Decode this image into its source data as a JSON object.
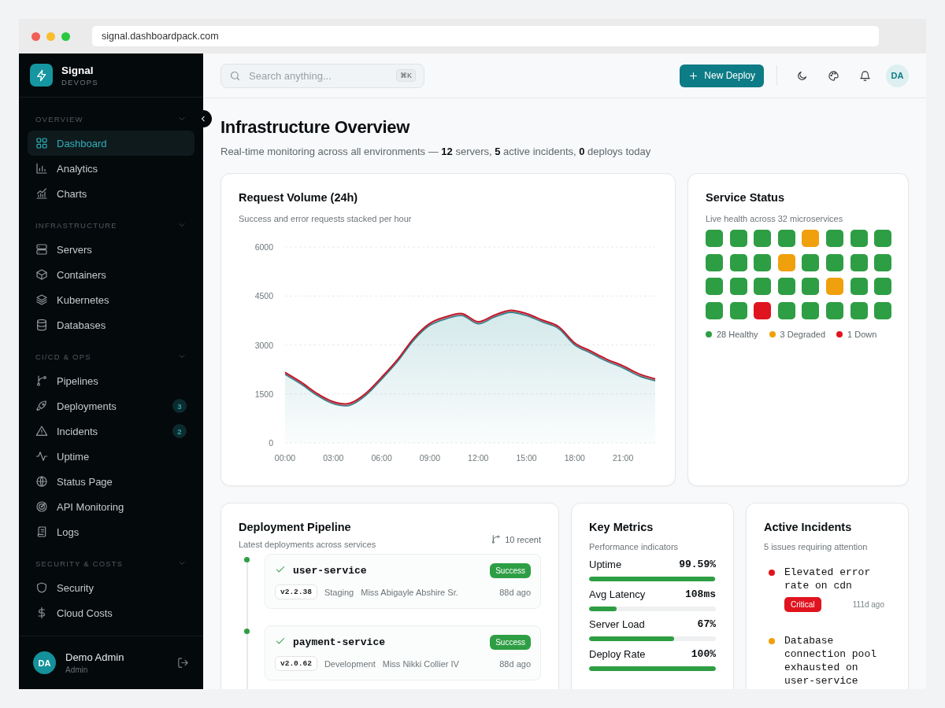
{
  "browser": {
    "url": "signal.dashboardpack.com"
  },
  "sidebar": {
    "brand": {
      "name": "Signal",
      "tagline": "DEVOPS"
    },
    "sections": [
      {
        "title": "OVERVIEW",
        "expanded": true,
        "items": [
          {
            "label": "Dashboard",
            "selected": true
          },
          {
            "label": "Analytics",
            "selected": false
          },
          {
            "label": "Charts",
            "selected": false
          }
        ]
      },
      {
        "title": "INFRASTRUCTURE",
        "expanded": true,
        "items": [
          {
            "label": "Servers",
            "selected": false
          },
          {
            "label": "Containers",
            "selected": false
          },
          {
            "label": "Kubernetes",
            "selected": false
          },
          {
            "label": "Databases",
            "selected": false
          }
        ]
      },
      {
        "title": "CI/CD & OPS",
        "expanded": true,
        "items": [
          {
            "label": "Pipelines",
            "selected": false
          },
          {
            "label": "Deployments",
            "selected": false,
            "badge": "3"
          },
          {
            "label": "Incidents",
            "selected": false,
            "badge": "2"
          },
          {
            "label": "Uptime",
            "selected": false
          },
          {
            "label": "Status Page",
            "selected": false
          },
          {
            "label": "API Monitoring",
            "selected": false
          },
          {
            "label": "Logs",
            "selected": false
          }
        ]
      },
      {
        "title": "SECURITY & COSTS",
        "expanded": true,
        "items": [
          {
            "label": "Security",
            "selected": false
          },
          {
            "label": "Cloud Costs",
            "selected": false
          }
        ]
      }
    ],
    "user": {
      "initials": "DA",
      "name": "Demo Admin",
      "role": "Admin"
    }
  },
  "topbar": {
    "search": {
      "placeholder": "Search anything...",
      "shortcut": "⌘K"
    },
    "new_deploy": "New Deploy",
    "avatar": "DA"
  },
  "page": {
    "title": "Infrastructure Overview",
    "subtitle": "Real-time monitoring across all environments — **12** servers, **5** active incidents, **0** deploys today"
  },
  "request_volume": {
    "title": "Request Volume (24h)",
    "subtitle": "Success and error requests stacked per hour",
    "chart_data": {
      "type": "area",
      "stacked": true,
      "grid": true,
      "x": [
        0,
        1,
        2,
        3,
        4,
        5,
        6,
        7,
        8,
        9,
        10,
        11,
        12,
        13,
        14,
        15,
        16,
        17,
        18,
        19,
        20,
        21,
        22,
        23
      ],
      "series": [
        {
          "color": "#2a8f99",
          "values": [
            2100,
            1800,
            1450,
            1200,
            1150,
            1450,
            1950,
            2500,
            3150,
            3600,
            3800,
            3900,
            3650,
            3850,
            4000,
            3900,
            3700,
            3500,
            3000,
            2750,
            2500,
            2300,
            2050,
            1900
          ]
        },
        {
          "color": "#c0182a",
          "values": [
            60,
            60,
            60,
            60,
            60,
            60,
            60,
            60,
            60,
            60,
            60,
            60,
            60,
            60,
            60,
            60,
            60,
            60,
            60,
            60,
            60,
            60,
            60,
            60
          ]
        }
      ],
      "xlim": [
        0,
        23
      ],
      "ylim": [
        0,
        6000
      ],
      "yticks": [
        0,
        1500,
        3000,
        4500,
        6000
      ],
      "xticks": [
        {
          "value": 0,
          "label": "00:00"
        },
        {
          "value": 3,
          "label": "03:00"
        },
        {
          "value": 6,
          "label": "06:00"
        },
        {
          "value": 9,
          "label": "09:00"
        },
        {
          "value": 12,
          "label": "12:00"
        },
        {
          "value": 15,
          "label": "15:00"
        },
        {
          "value": 18,
          "label": "18:00"
        },
        {
          "value": 21,
          "label": "21:00"
        }
      ]
    }
  },
  "service_status": {
    "title": "Service Status",
    "subtitle": "Live health across 32 microservices",
    "services": [
      {
        "color": "#2e9e44"
      },
      {
        "color": "#2e9e44"
      },
      {
        "color": "#2e9e44"
      },
      {
        "color": "#2e9e44"
      },
      {
        "color": "#f0a00c"
      },
      {
        "color": "#2e9e44"
      },
      {
        "color": "#2e9e44"
      },
      {
        "color": "#2e9e44"
      },
      {
        "color": "#2e9e44"
      },
      {
        "color": "#2e9e44"
      },
      {
        "color": "#2e9e44"
      },
      {
        "color": "#f0a00c"
      },
      {
        "color": "#2e9e44"
      },
      {
        "color": "#2e9e44"
      },
      {
        "color": "#2e9e44"
      },
      {
        "color": "#2e9e44"
      },
      {
        "color": "#2e9e44"
      },
      {
        "color": "#2e9e44"
      },
      {
        "color": "#2e9e44"
      },
      {
        "color": "#2e9e44"
      },
      {
        "color": "#2e9e44"
      },
      {
        "color": "#f0a00c"
      },
      {
        "color": "#2e9e44"
      },
      {
        "color": "#2e9e44"
      },
      {
        "color": "#2e9e44"
      },
      {
        "color": "#2e9e44"
      },
      {
        "color": "#e0141e"
      },
      {
        "color": "#2e9e44"
      },
      {
        "color": "#2e9e44"
      },
      {
        "color": "#2e9e44"
      },
      {
        "color": "#2e9e44"
      },
      {
        "color": "#2e9e44"
      }
    ],
    "legend": [
      {
        "label": "28 Healthy",
        "color": "#2e9e44"
      },
      {
        "label": "3 Degraded",
        "color": "#f0a00c"
      },
      {
        "label": "1 Down",
        "color": "#e0141e"
      }
    ]
  },
  "deployment_pipeline": {
    "title": "Deployment Pipeline",
    "subtitle": "Latest deployments across services",
    "count": "10 recent",
    "deployments": [
      {
        "service": "user-service",
        "status": "Success",
        "version": "v2.2.38",
        "environment": "Staging",
        "author": "Miss Abigayle Abshire Sr.",
        "time": "88d ago"
      },
      {
        "service": "payment-service",
        "status": "Success",
        "version": "v2.0.62",
        "environment": "Development",
        "author": "Miss Nikki Collier IV",
        "time": "88d ago"
      }
    ]
  },
  "key_metrics": {
    "title": "Key Metrics",
    "subtitle": "Performance indicators",
    "metrics": [
      {
        "label": "Uptime",
        "value": "99.59%",
        "level": 0.9959
      },
      {
        "label": "Avg Latency",
        "value": "108ms",
        "level": 0.22
      },
      {
        "label": "Server Load",
        "value": "67%",
        "level": 0.67
      },
      {
        "label": "Deploy Rate",
        "value": "100%",
        "level": 1
      }
    ]
  },
  "active_incidents": {
    "title": "Active Incidents",
    "subtitle": "5 issues requiring attention",
    "incidents": [
      {
        "title": "Elevated error rate on cdn",
        "color": "#e0141e",
        "severity": "Critical",
        "time": "111d ago"
      },
      {
        "title": "Database connection pool exhausted on user-service",
        "color": "#f0a00c"
      }
    ]
  }
}
